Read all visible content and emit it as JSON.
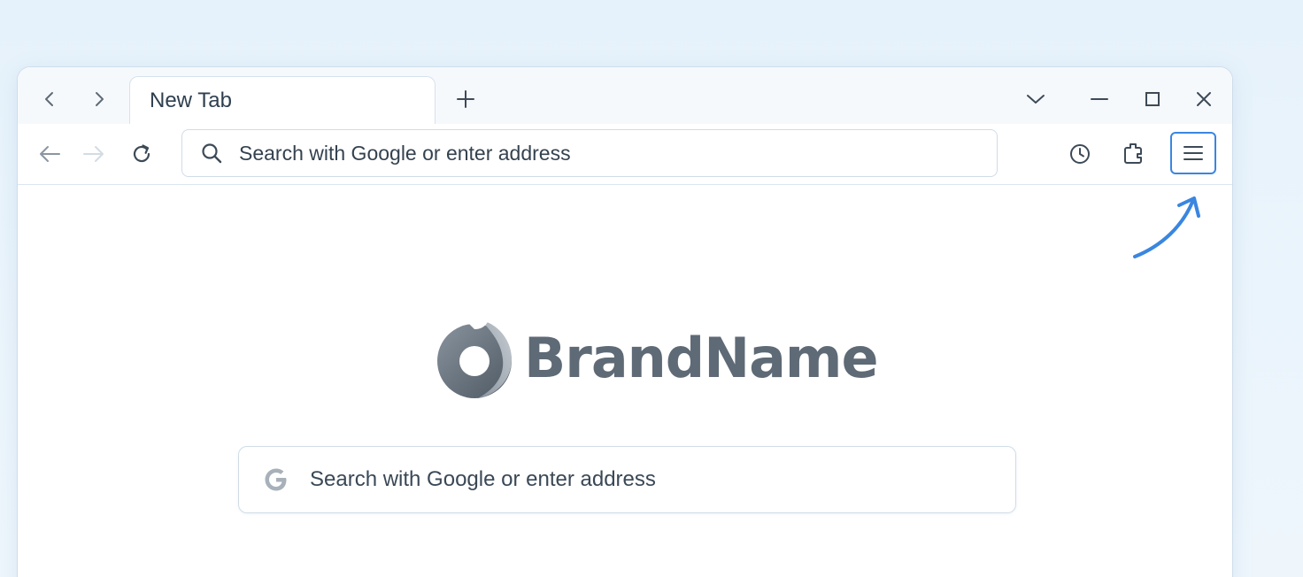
{
  "tabstrip": {
    "back_icon": "chevron-left-icon",
    "forward_icon": "chevron-right-icon",
    "active_tab": {
      "title": "New Tab"
    },
    "new_tab_icon": "plus-icon",
    "tab_list_icon": "chevron-down-icon",
    "window_controls": [
      "minimize-icon",
      "maximize-icon",
      "close-icon"
    ]
  },
  "toolbar": {
    "back_icon": "arrow-left-icon",
    "forward_icon": "arrow-right-icon",
    "reload_icon": "reload-icon",
    "address_bar": {
      "icon": "search-icon",
      "placeholder": "Search with Google or enter address"
    },
    "history_icon": "clock-icon",
    "extensions_icon": "puzzle-icon",
    "menu_icon": "hamburger-menu-icon",
    "menu_highlight_color": "#3a86e0"
  },
  "content": {
    "brand": {
      "logo_icon": "brand-logo-icon",
      "name": "BrandName"
    },
    "search": {
      "icon": "google-g-icon",
      "placeholder": "Search with Google or enter address"
    }
  },
  "annotation": {
    "arrow_icon": "pointer-arrow-icon",
    "color": "#3a86e0"
  }
}
